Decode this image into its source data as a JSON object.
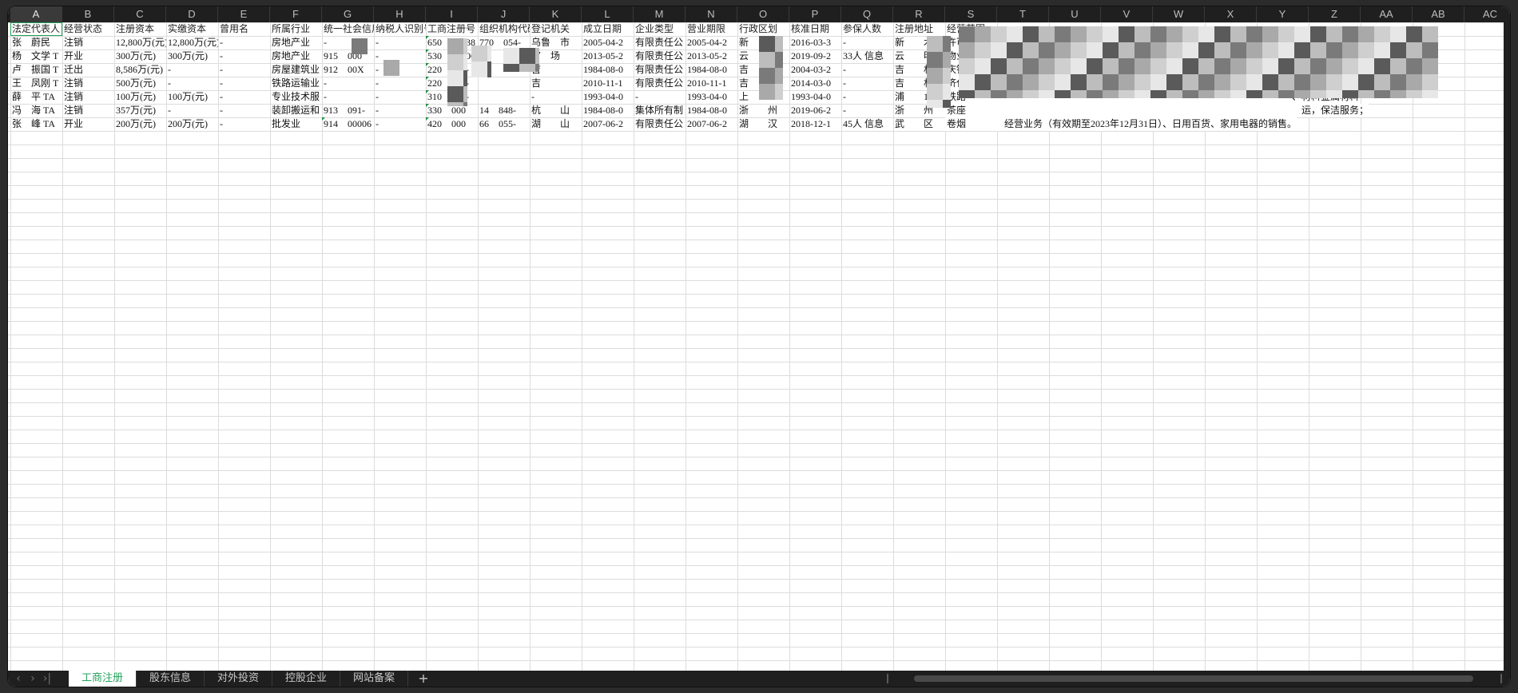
{
  "columns": [
    "A",
    "B",
    "C",
    "D",
    "E",
    "F",
    "G",
    "H",
    "I",
    "J",
    "K",
    "L",
    "M",
    "N",
    "O",
    "P",
    "Q",
    "R",
    "S",
    "T",
    "U",
    "V",
    "W",
    "X",
    "Y",
    "Z",
    "AA",
    "AB",
    "AC"
  ],
  "selected_column": "A",
  "headers": [
    "法定代表人",
    "经营状态",
    "注册资本",
    "实缴资本",
    "曾用名",
    "所属行业",
    "统一社会信用代码",
    "纳税人识别号",
    "工商注册号",
    "组织机构代码",
    "登记机关",
    "成立日期",
    "企业类型",
    "营业期限",
    "行政区划",
    "核准日期",
    "参保人数",
    "注册地址",
    "经营范围"
  ],
  "rows": [
    [
      "张　蔚民",
      "注销",
      "12,800万(元)",
      "12,800万(元)",
      "-",
      "房地产业",
      "-",
      "-",
      "650　　038",
      "770　054-",
      "乌鲁　市",
      "2005-04-2",
      "有限责任公",
      "2005-04-2",
      "新　　区",
      "2016-03-3",
      "-",
      "新　　木",
      "许可　　　　　　　　　　　　　　　　　　　　　　　　　　　　　　　　　　　　　　　　；餐饮服务；消"
    ],
    [
      "杨　文学 T",
      "开业",
      "300万(元)",
      "300万(元)",
      "-",
      "房地产业",
      "915　000",
      "-",
      "530　　000",
      "06　　543-",
      "官　场",
      "2013-05-2",
      "有限责任公",
      "2013-05-2",
      "云　　明",
      "2019-09-2",
      "33人 信息",
      "云　　明",
      "物业"
    ],
    [
      "卢　振国 T",
      "迁出",
      "8,586万(元)",
      "-",
      "-",
      "房屋建筑业",
      "912　00X",
      "-",
      "220　103-",
      "　　　　　",
      "吉　　",
      "1984-08-0",
      "有限责任公",
      "1984-08-0",
      "吉　　林",
      "2004-03-2",
      "-",
      "吉　　林",
      "庆铁路　　　　　　　　　　　　　　　　　　　　　　　　　　　　　　　　　　；混凝土予制构"
    ],
    [
      "王　凤刚 T",
      "注销",
      "500万(元)",
      "-",
      "-",
      "铁路运输业",
      "-",
      "-",
      "220　000-",
      "　　　　　",
      "吉　　",
      "2010-11-1",
      "有限责任公",
      "2010-11-1",
      "吉　　林",
      "2014-03-0",
      "-",
      "吉　　林",
      "济代办　　　　　　　　　　　　　　　　　　　　　　　　　　　　　　　　　材）、碳素制品"
    ],
    [
      "薛　平 TA",
      "注销",
      "100万(元)",
      "100万(元)",
      "-",
      "专业技术服",
      "-",
      "-",
      "310　000-",
      "　　　　　",
      "-",
      "1993-04-0",
      "-",
      "1993-04-0",
      "上　　",
      "1993-04-0",
      "-",
      "浦　　13",
      "铁路　　　　　　　　　　　　　　　　　　　　　　　　　　　　　　　　　　、材料金属材料"
    ],
    [
      "冯　海 TA",
      "注销",
      "357万(元)",
      "-",
      "-",
      "装卸搬运和",
      "913　091-",
      "-",
      "330　000",
      "14　848-",
      "杭　　山",
      "1984-08-0",
      "集体所有制",
      "1984-08-0",
      "浙　　州",
      "2019-06-2",
      "-",
      "浙　　州",
      "茶座　　　　　　　　　　　　　　　　　　　　　　　　　　　　　　　　　　　运，保洁服务；"
    ],
    [
      "张　峰 TA",
      "开业",
      "200万(元)",
      "200万(元)",
      "-",
      "批发业",
      "914　00006",
      "-",
      "420　000",
      "66　055-",
      "湖　　山",
      "2007-06-2",
      "有限责任公",
      "2007-06-2",
      "湖　　汉",
      "2018-12-1",
      "45人 信息",
      "武　　区",
      "卷烟　　　　经营业务（有效期至2023年12月31日）、日用百货、家用电器的销售。"
    ]
  ],
  "sheet_tabs": [
    "工商注册",
    "股东信息",
    "对外投资",
    "控股企业",
    "网站备案"
  ],
  "active_tab": "工商注册",
  "colors": {
    "accent": "#1e9e58",
    "chrome": "#1f1f1f",
    "grid_line": "#dcdcdc",
    "active_tab_text": "#27a35e"
  },
  "icons": {
    "first_sheet": "chevron-left-icon",
    "next_sheet": "chevron-right-icon",
    "last_sheet": "chevron-end-icon",
    "add_sheet": "plus-icon"
  }
}
